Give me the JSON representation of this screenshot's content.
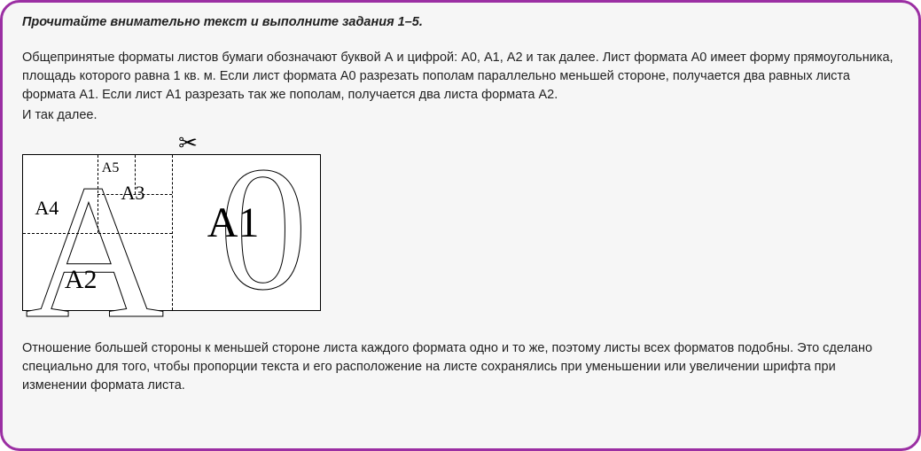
{
  "instruction": "Прочитайте внимательно текст и выполните задания 1–5.",
  "paragraph1": "Общепринятые форматы листов бумаги обозначают буквой А и цифрой: А0, А1, А2 и так далее. Лист формата А0 имеет форму прямоугольника, площадь которого равна 1 кв. м. Если лист формата А0 разрезать пополам параллельно меньшей стороне, получается два равных листа формата А1. Если лист А1 разрезать так же пополам, получается два листа формата А2.",
  "paragraph1_tail": "И так далее.",
  "paragraph2": "Отношение большей стороны к меньшей стороне листа каждого формата одно и то же, поэтому листы всех форматов подобны. Это сделано специально для того, чтобы пропорции текста и его расположение на листе сохранялись при уменьшении или увеличении шрифта при изменении формата листа.",
  "figure": {
    "labels": {
      "a5": "A5",
      "a4": "A4",
      "a3": "A3",
      "a2": "A2",
      "a1": "A1"
    },
    "big_a": "A",
    "big_zero": "0",
    "scissors": "✂"
  }
}
